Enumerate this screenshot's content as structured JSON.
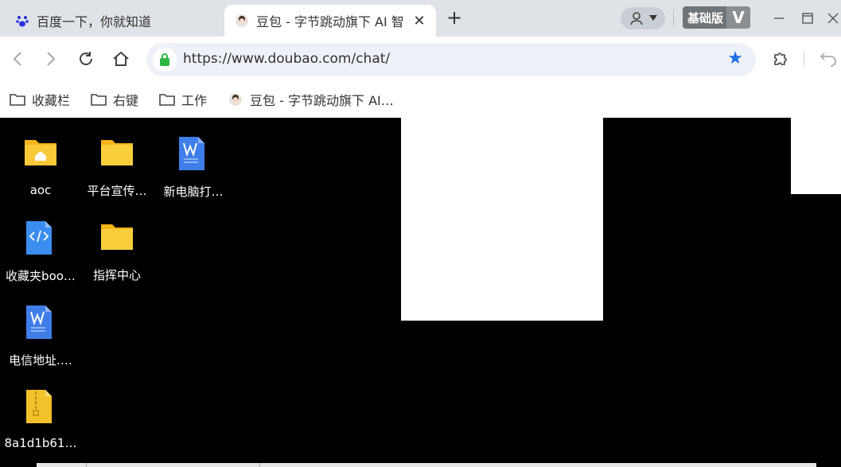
{
  "tabs": [
    {
      "title": "百度一下，你就知道",
      "active": false
    },
    {
      "title": "豆包 - 字节跳动旗下 AI 智",
      "active": true
    }
  ],
  "profile_badge": "基础版",
  "profile_badge_v": "V",
  "address": {
    "url": "https://www.doubao.com/chat/"
  },
  "bookmarks": [
    {
      "label": "收藏栏",
      "icon": "folder-icon"
    },
    {
      "label": "右键",
      "icon": "folder-icon"
    },
    {
      "label": "工作",
      "icon": "folder-icon"
    },
    {
      "label": "豆包 - 字节跳动旗下 AI…",
      "icon": "doubao-avatar-icon"
    }
  ],
  "desktop_icons": [
    {
      "label": "aoc",
      "type": "home-folder"
    },
    {
      "label": "平台宣传…",
      "type": "folder"
    },
    {
      "label": "新电脑打…",
      "type": "word-doc"
    },
    {
      "label": "收藏夹boo…",
      "type": "html-file"
    },
    {
      "label": "指挥中心",
      "type": "folder"
    },
    {
      "label": "电信地址.…",
      "type": "word-doc"
    },
    {
      "label": "8a1d1b61…",
      "type": "zip-file"
    }
  ],
  "colors": {
    "accent": "#1e6fe8",
    "tabstrip": "#dfe3e8",
    "folder": "#f5c518",
    "lock": "#2db742"
  }
}
